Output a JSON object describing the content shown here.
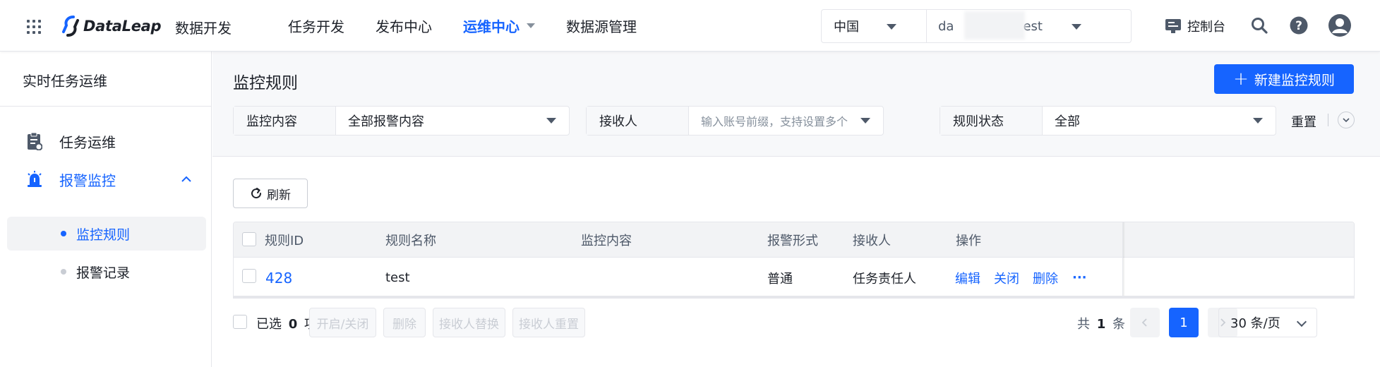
{
  "header": {
    "product_name": "数据开发",
    "logo_text": "DataLeap",
    "nav": [
      {
        "label": "任务开发",
        "active": false
      },
      {
        "label": "发布中心",
        "active": false
      },
      {
        "label": "运维中心",
        "active": true
      },
      {
        "label": "数据源管理",
        "active": false
      }
    ],
    "region": "中国",
    "project_prefix": "da",
    "project_suffix": "est",
    "console_label": "控制台",
    "icons": [
      "apps-grid-icon",
      "console-icon",
      "search-icon",
      "help-icon",
      "user-avatar-icon"
    ],
    "accent_color": "#1664ff"
  },
  "sidebar": {
    "title": "实时任务运维",
    "items": [
      {
        "label": "任务运维",
        "icon": "task-clipboard-icon"
      },
      {
        "label": "报警监控",
        "icon": "alarm-icon",
        "expanded": true
      }
    ],
    "sub_items": [
      {
        "label": "监控规则",
        "active": true
      },
      {
        "label": "报警记录",
        "active": false
      }
    ]
  },
  "main": {
    "title": "监控规则",
    "create_button": "新建监控规则",
    "filters": {
      "content_label": "监控内容",
      "content_value": "全部报警内容",
      "receiver_label": "接收人",
      "receiver_placeholder": "输入账号前缀，支持设置多个",
      "status_label": "规则状态",
      "status_value": "全部",
      "reset": "重置"
    },
    "refresh": "刷新",
    "table": {
      "columns": [
        "规则ID",
        "规则名称",
        "监控内容",
        "报警形式",
        "接收人",
        "操作"
      ],
      "rows": [
        {
          "id": "428",
          "name": "test",
          "content": "",
          "alert_type": "普通",
          "receiver": "任务责任人",
          "actions": [
            "编辑",
            "关闭",
            "删除",
            "···"
          ]
        }
      ]
    },
    "footer": {
      "selected_prefix": "已选",
      "selected_count": "0",
      "selected_suffix": "项",
      "batch_buttons": [
        "开启/关闭",
        "删除",
        "接收人替换",
        "接收人重置"
      ],
      "total_prefix": "共",
      "total_count": "1",
      "total_suffix": "条",
      "current_page": "1",
      "page_size": "30 条/页"
    }
  }
}
